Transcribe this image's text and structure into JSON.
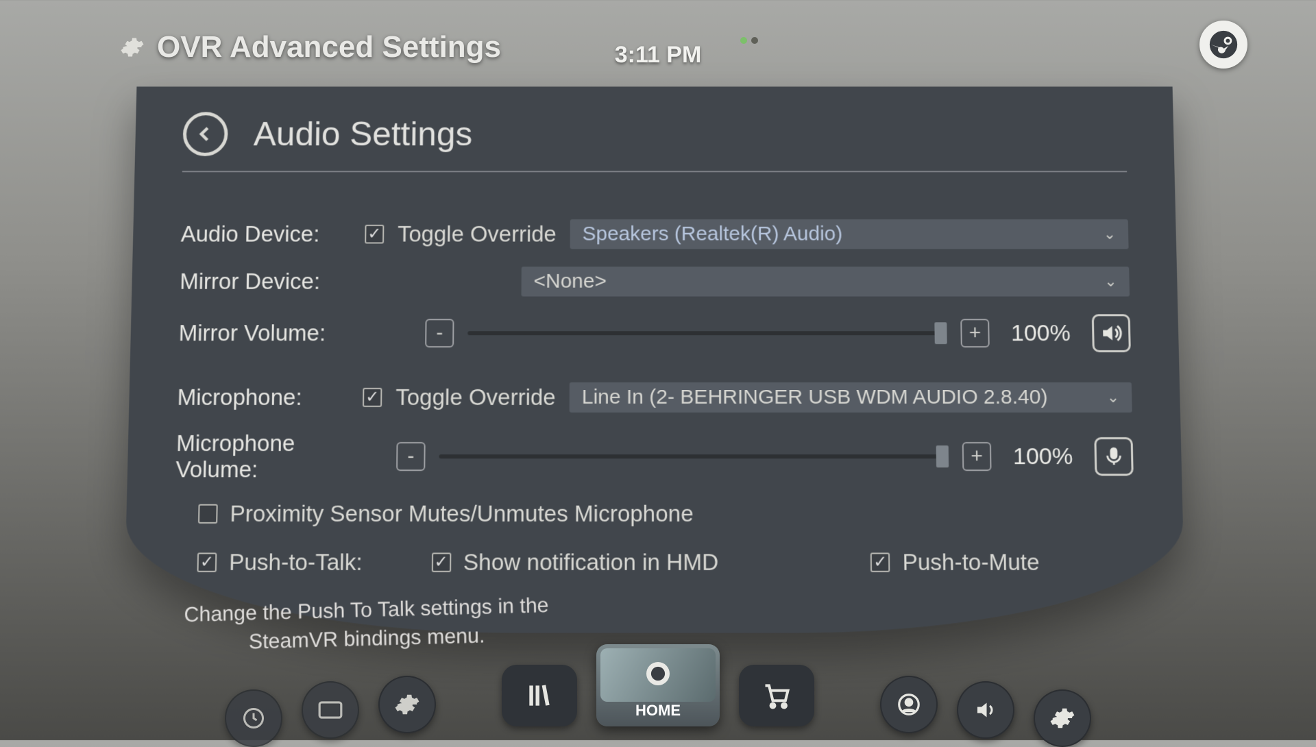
{
  "header": {
    "app_title": "OVR Advanced Settings",
    "clock": "3:11 PM"
  },
  "panel": {
    "title": "Audio Settings"
  },
  "audio": {
    "device_label": "Audio Device:",
    "toggle_override_label": "Toggle Override",
    "toggle_override_checked": true,
    "device_selected": "Speakers (Realtek(R) Audio)",
    "mirror_label": "Mirror Device:",
    "mirror_selected": "<None>",
    "mirror_volume_label": "Mirror Volume:",
    "mirror_volume_minus": "-",
    "mirror_volume_plus": "+",
    "mirror_volume_value": "100%",
    "mic_label": "Microphone:",
    "mic_toggle_override_checked": true,
    "mic_selected": "Line In (2- BEHRINGER USB WDM AUDIO 2.8.40)",
    "mic_volume_label": "Microphone Volume:",
    "mic_volume_minus": "-",
    "mic_volume_plus": "+",
    "mic_volume_value": "100%",
    "proximity_checked": false,
    "proximity_label": "Proximity Sensor Mutes/Unmutes Microphone",
    "ptt_checked": true,
    "ptt_label": "Push-to-Talk:",
    "show_notif_checked": true,
    "show_notif_label": "Show notification in HMD",
    "ptm_checked": true,
    "ptm_label": "Push-to-Mute",
    "hint": "Change the Push To Talk settings in the SteamVR bindings menu."
  },
  "dock": {
    "home_label": "HOME"
  }
}
